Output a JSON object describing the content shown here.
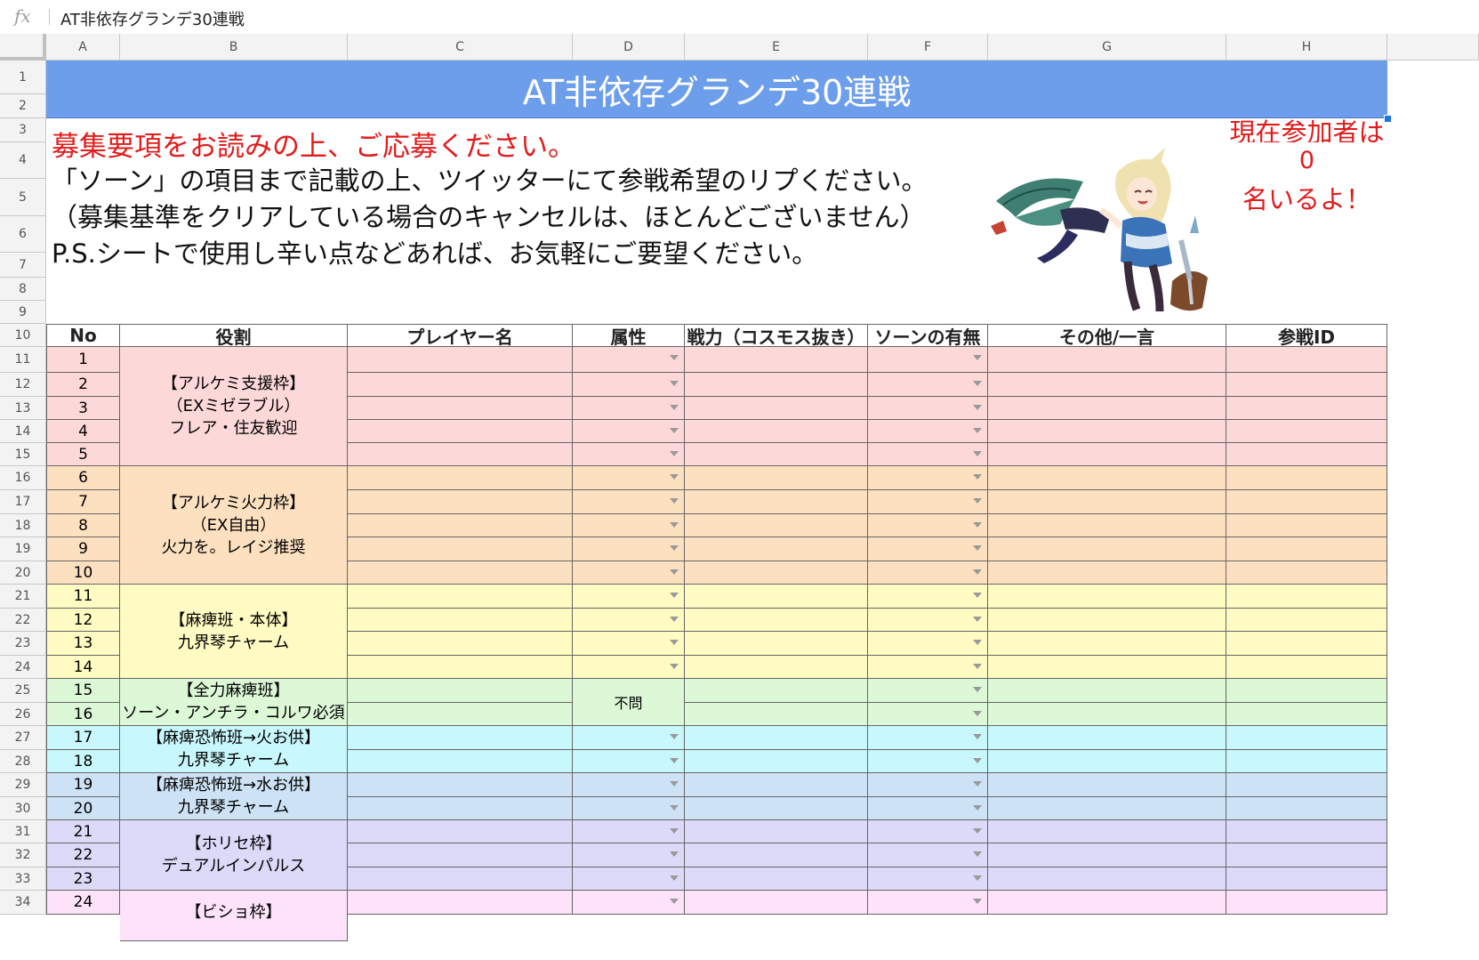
{
  "formula_bar": {
    "fx_label": "fx",
    "value": "AT非依存グランデ30連戦"
  },
  "columns": [
    "A",
    "B",
    "C",
    "D",
    "E",
    "F",
    "G",
    "H"
  ],
  "rows": [
    "1",
    "2",
    "3",
    "4",
    "5",
    "6",
    "7",
    "8",
    "9",
    "10",
    "11",
    "12",
    "13",
    "14",
    "15",
    "16",
    "17",
    "18",
    "19",
    "20",
    "21",
    "22",
    "23",
    "24",
    "25",
    "26",
    "27",
    "28",
    "29",
    "30",
    "31",
    "32",
    "33",
    "34"
  ],
  "title": "AT非依存グランデ30連戦",
  "notice": {
    "line1": "募集要項をお読みの上、ご応募ください。",
    "line2": "「ソーン」の項目まで記載の上、ツイッターにて参戦希望のリプください。",
    "line3": "（募集基準をクリアしている場合のキャンセルは、ほとんどございません）",
    "line4": "P.S.シートで使用し辛い点などあれば、お気軽にご要望ください。"
  },
  "participants": {
    "label_top": "現在参加者は",
    "count": "0",
    "label_bottom": "名いるよ！"
  },
  "headers": [
    "No",
    "役割",
    "プレイヤー名",
    "属性",
    "戦力（コスモス抜き）",
    "ソーンの有無",
    "その他/一言",
    "参戦ID"
  ],
  "numbers": [
    "1",
    "2",
    "3",
    "4",
    "5",
    "6",
    "7",
    "8",
    "9",
    "10",
    "11",
    "12",
    "13",
    "14",
    "15",
    "16",
    "17",
    "18",
    "19",
    "20",
    "21",
    "22",
    "23",
    "24"
  ],
  "groups": [
    {
      "role": [
        "【アルケミ支援枠】",
        "（EXミゼラブル）",
        "フレア・住友歓迎"
      ],
      "color": "#fdd8d8"
    },
    {
      "role": [
        "【アルケミ火力枠】",
        "（EX自由）",
        "火力を。レイジ推奨"
      ],
      "color": "#fde0c0"
    },
    {
      "role": [
        "【麻痺班・本体】",
        "九界琴チャーム"
      ],
      "color": "#fffbc2"
    },
    {
      "role": [
        "【全力麻痺班】",
        "ソーン・アンチラ・コルワ必須"
      ],
      "color": "#dcf8d6"
    },
    {
      "role": [
        "【麻痺恐怖班→火お供】",
        "九界琴チャーム"
      ],
      "color": "#c8f7fc"
    },
    {
      "role": [
        "【麻痺恐怖班→水お供】",
        "九界琴チャーム"
      ],
      "color": "#cde3f5"
    },
    {
      "role": [
        "【ホリセ枠】",
        "デュアルインパルス"
      ],
      "color": "#dcd9f9"
    },
    {
      "role": [
        "【ビショ枠】"
      ],
      "color": "#fde2fa"
    }
  ],
  "attribute_fixed": "不問",
  "colors": {
    "title_bg": "#6d9eeb",
    "accent_red": "#e21b1b",
    "header_text": "#222222",
    "selection": "#1a73e8"
  }
}
